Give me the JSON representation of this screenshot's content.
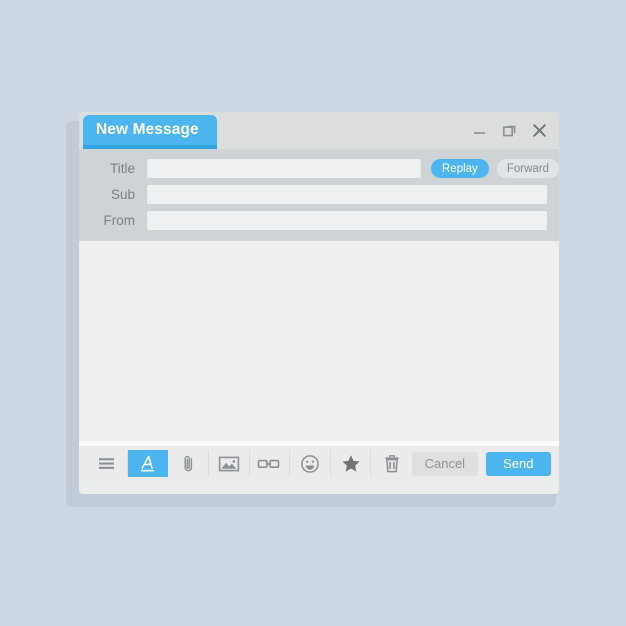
{
  "window": {
    "tab_label": "New Message",
    "controls": [
      {
        "name": "minimize-button",
        "icon": "minimize-icon"
      },
      {
        "name": "maximize-button",
        "icon": "maximize-icon"
      },
      {
        "name": "close-button",
        "icon": "close-icon"
      }
    ]
  },
  "form": {
    "fields": [
      {
        "label": "Title",
        "value": "",
        "placeholder": ""
      },
      {
        "label": "Sub",
        "value": "",
        "placeholder": ""
      },
      {
        "label": "From",
        "value": "",
        "placeholder": ""
      }
    ],
    "replay_label": "Replay",
    "forward_label": "Forward"
  },
  "body": {
    "value": "",
    "placeholder": ""
  },
  "toolbar": {
    "tools": [
      {
        "name": "menu-button",
        "icon": "hamburger-menu-icon",
        "active": false
      },
      {
        "name": "text-format-button",
        "icon": "text-format-a-icon",
        "active": true
      },
      {
        "name": "attachment-button",
        "icon": "paperclip-icon",
        "active": false
      },
      {
        "name": "insert-image-button",
        "icon": "image-icon",
        "active": false
      },
      {
        "name": "insert-link-button",
        "icon": "link-icon",
        "active": false
      },
      {
        "name": "emoji-button",
        "icon": "smiley-icon",
        "active": false
      },
      {
        "name": "favorite-button",
        "icon": "star-icon",
        "active": false
      },
      {
        "name": "delete-button",
        "icon": "trash-icon",
        "active": false
      }
    ],
    "cancel_label": "Cancel",
    "send_label": "Send"
  },
  "colors": {
    "page_background": "#ced8e5",
    "accent_blue": "#4cb4ee",
    "tab_underline": "#33a4e2",
    "titlebar": "#dcdddd",
    "fields_panel": "#ced3d6",
    "input_background": "#eef0f1",
    "body_background": "#efefef",
    "toolbar_background": "#ebebeb",
    "cancel_background": "#dfdfdf",
    "label_text": "#7b8085",
    "icon_grey": "#8b9094"
  }
}
